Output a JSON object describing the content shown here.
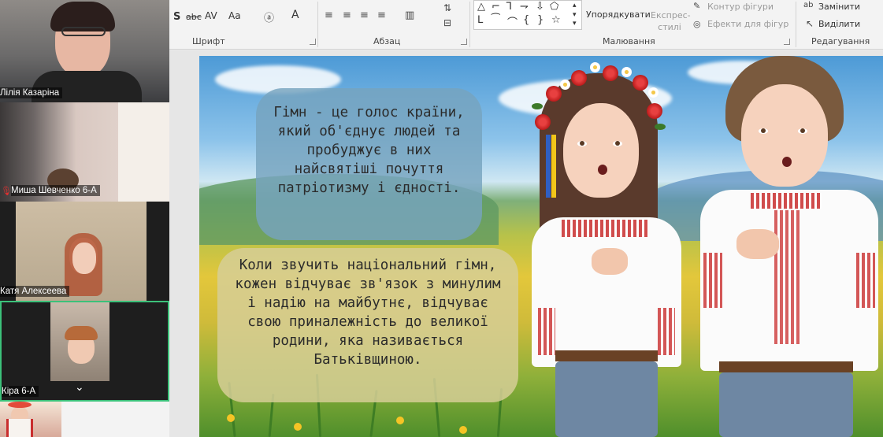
{
  "ribbon": {
    "group_font": "Шрифт",
    "group_paragraph": "Абзац",
    "group_drawing": "Малювання",
    "group_editing": "Редагування",
    "arrange": "Упорядкувати",
    "quick_styles": "Експрес-стилі",
    "shape_outline": "Контур фігури",
    "shape_effects": "Ефекти для фігур",
    "replace": "Замінити",
    "select": "Виділити",
    "font_strike": "abc",
    "font_spacing": "AV",
    "font_size_change": "Aa",
    "font_color": "A",
    "font_shadow": "S"
  },
  "participants": [
    {
      "name": "Лілія Казаріна"
    },
    {
      "name": "Миша Шевченко 6-А",
      "muted": true
    },
    {
      "name": "Катя Алексеева"
    },
    {
      "name": "Кіра 6-А",
      "active_speaker": true
    }
  ],
  "slide": {
    "text1": "Гімн - це голос країни, який об'єднує людей та пробуджує в них найсвятіші почуття патріотизму і єдності.",
    "text2": "Коли звучить національний гімн, кожен відчуває зв'язок з минулим і надію на майбутнє, відчуває свою приналежність до великої родини, яка називається Батьківщиною."
  },
  "colors": {
    "active_speaker_border": "#3cc17a",
    "bubble1": "#76a4be",
    "bubble2": "#d6ce96",
    "embroidery": "#c92d2d"
  }
}
